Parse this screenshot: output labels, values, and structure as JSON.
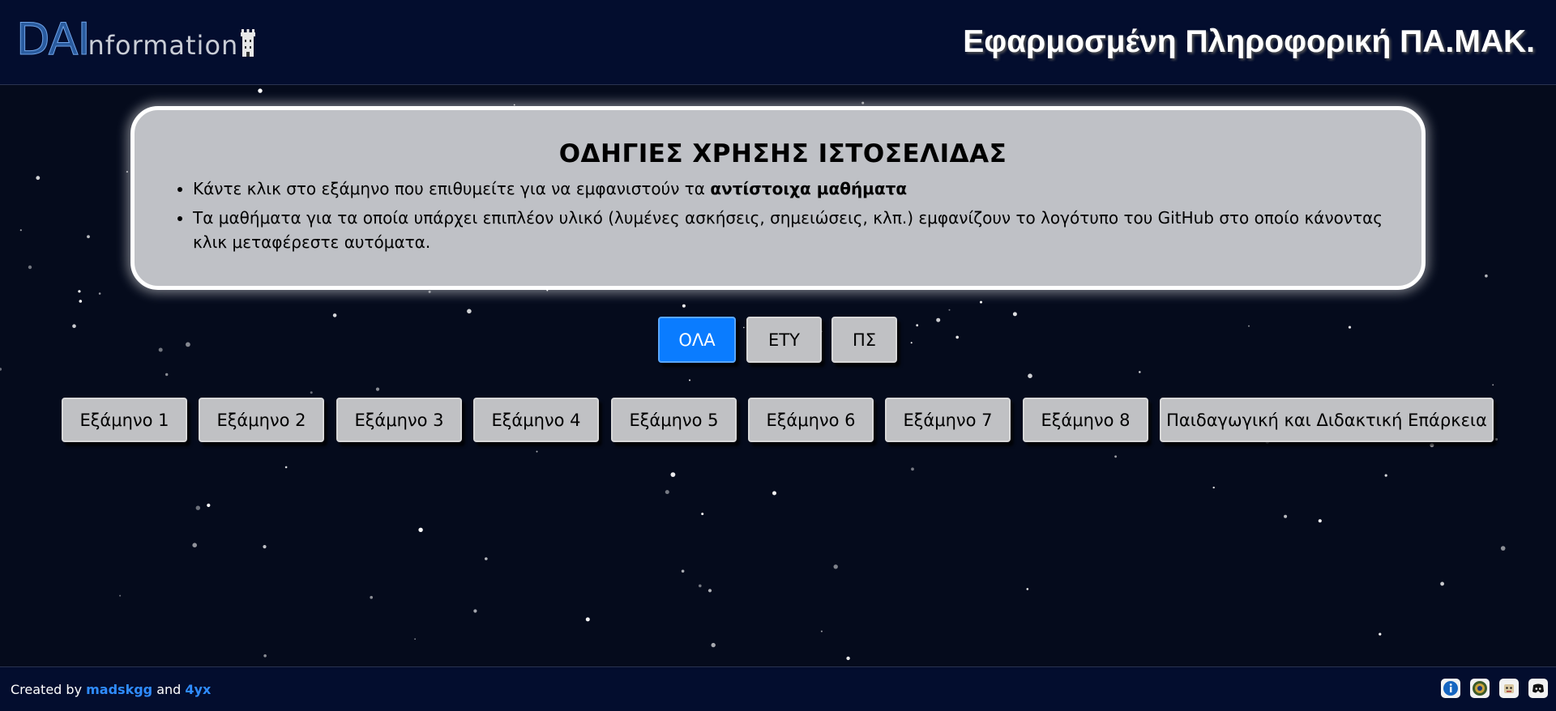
{
  "header": {
    "logo_dai": "DAI",
    "logo_information": "nformation",
    "title": "Εφαρμοσμένη Πληροφορική ΠΑ.ΜΑΚ."
  },
  "instructions": {
    "heading": "ΟΔΗΓΙΕΣ ΧΡΗΣΗΣ ΙΣΤΟΣΕΛΙΔΑΣ",
    "item1_prefix": "Κάντε κλικ στο εξάμηνο που επιθυμείτε για να εμφανιστούν τα ",
    "item1_bold": "αντίστοιχα μαθήματα",
    "item2": "Τα μαθήματα για τα οποία υπάρχει επιπλέον υλικό (λυμένες ασκήσεις, σημειώσεις, κλπ.) εμφανίζουν το λογότυπο του GitHub στο οποίο κάνοντας κλικ μεταφέρεστε αυτόματα."
  },
  "filters": {
    "all": "ΟΛΑ",
    "ety": "ΕΤΥ",
    "ps": "ΠΣ",
    "active": "ΟΛΑ"
  },
  "semesters": {
    "s1": "Εξάμηνο 1",
    "s2": "Εξάμηνο 2",
    "s3": "Εξάμηνο 3",
    "s4": "Εξάμηνο 4",
    "s5": "Εξάμηνο 5",
    "s6": "Εξάμηνο 6",
    "s7": "Εξάμηνο 7",
    "s8": "Εξάμηνο 8",
    "pedagogy": "Παιδαγωγική και Διδακτική Επάρκεια"
  },
  "footer": {
    "created_by": "Created by",
    "author1": "madskgg",
    "and": "and",
    "author2": "4yx",
    "icons": [
      "info-icon",
      "university-seal-icon",
      "mascot-icon",
      "discord-icon"
    ]
  },
  "colors": {
    "background": "#050b1c",
    "header": "#030d2e",
    "accent": "#0a7cff",
    "button": "#c0c1c4",
    "panel": "#bfc1c6"
  }
}
